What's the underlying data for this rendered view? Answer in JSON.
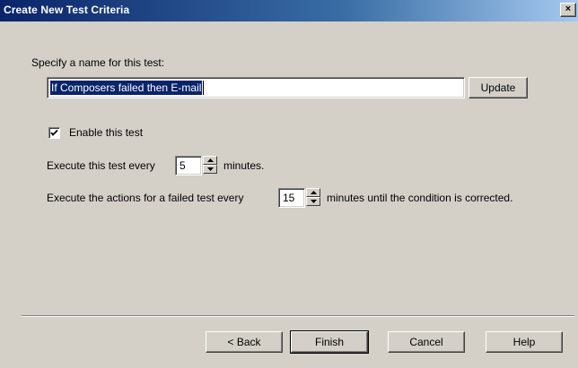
{
  "window": {
    "title": "Create New Test Criteria",
    "close_glyph": "×"
  },
  "form": {
    "name_label": "Specify a name for this test:",
    "name_value": "If Composers failed then E-mail",
    "update_label": "Update",
    "enable_label": "Enable this test",
    "enable_checked": true,
    "exec_prefix": "Execute this test every",
    "exec_value": "5",
    "exec_suffix": "minutes.",
    "actions_prefix": "Execute the actions for a failed test every",
    "actions_value": "15",
    "actions_suffix": "minutes until the condition is corrected."
  },
  "footer": {
    "back_label": "< Back",
    "finish_label": "Finish",
    "cancel_label": "Cancel",
    "help_label": "Help"
  },
  "colors": {
    "title_bar": "#0a246a",
    "face": "#d4d0c8",
    "selection": "#0a246a"
  },
  "icons": {
    "close": "close-icon",
    "checkmark": "checkmark-icon",
    "spin_up": "arrow-up-icon",
    "spin_down": "arrow-down-icon"
  }
}
